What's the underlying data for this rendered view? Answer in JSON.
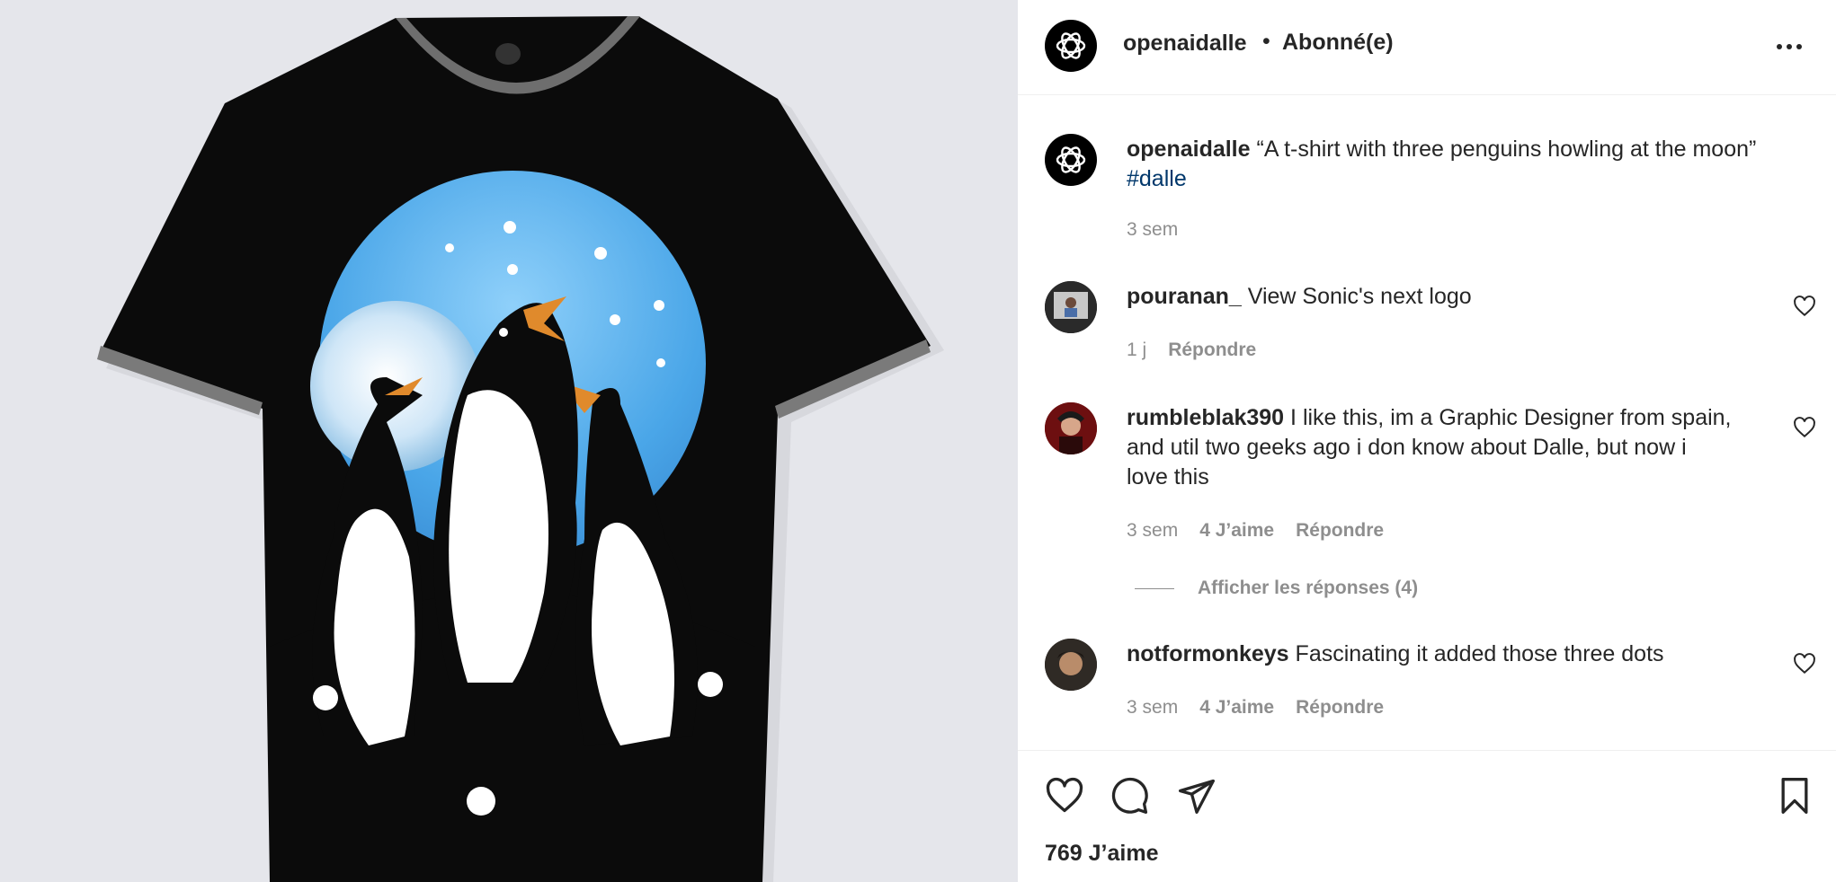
{
  "post": {
    "username": "openaidalle",
    "separator": "•",
    "follow_status": "Abonné(e)",
    "more_icon": "more-horizontal-icon"
  },
  "caption": {
    "username": "openaidalle",
    "text": "“A t-shirt with three penguins howling at the moon”",
    "hashtag": "#dalle",
    "time": "3 sem"
  },
  "comments": [
    {
      "username": "pouranan_",
      "text": "View Sonic's next logo",
      "time": "1 j",
      "likes": "",
      "reply": "Répondre"
    },
    {
      "username": "rumbleblak390",
      "text_line1": "I like this, im a Graphic Designer from spain,",
      "text_line2": "and util two geeks ago i don know about Dalle, but now i",
      "text_line3": "love this",
      "time": "3 sem",
      "likes": "4 J’aime",
      "reply": "Répondre",
      "view_replies": "Afficher les réponses (4)"
    },
    {
      "username": "notformonkeys",
      "text": "Fascinating it added those three dots",
      "time": "3 sem",
      "likes": "4 J’aime",
      "reply": "Répondre"
    }
  ],
  "actions": {
    "like_icon": "heart-icon",
    "comment_icon": "comment-icon",
    "share_icon": "send-icon",
    "save_icon": "bookmark-icon",
    "likes_count": "769 J’aime"
  },
  "colors": {
    "text": "#262626",
    "muted": "#8e8e8e",
    "hashtag": "#00376b",
    "moon_sky": "#4aa6e8"
  }
}
